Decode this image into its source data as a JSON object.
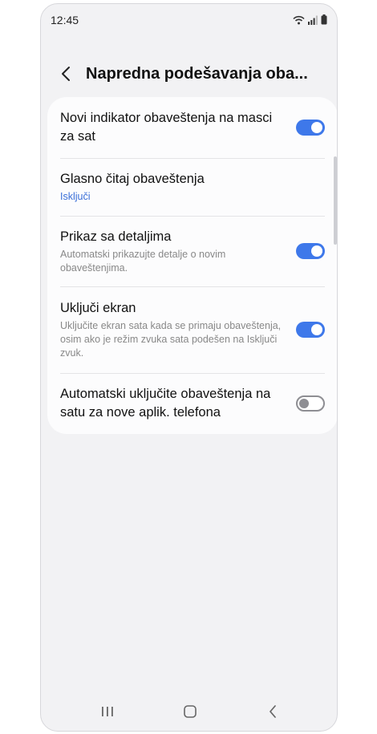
{
  "status_bar": {
    "time": "12:45"
  },
  "header": {
    "title": "Napredna podešavanja oba..."
  },
  "settings": [
    {
      "title": "Novi indikator obaveštenja na masci za sat",
      "subtitle": "",
      "toggle": true
    },
    {
      "title": "Glasno čitaj obaveštenja",
      "subtitle": "Isključi",
      "subtitle_color": "#3a6fd8"
    },
    {
      "title": "Prikaz sa detaljima",
      "subtitle": "Automatski prikazujte detalje o novim obaveštenjima.",
      "toggle": true
    },
    {
      "title": "Uključi ekran",
      "subtitle": "Uključite ekran sata kada se primaju obaveštenja, osim ako je režim zvuka sata podešen na Isključi zvuk.",
      "toggle": true
    },
    {
      "title": "Automatski uključite obaveštenja na satu za nove aplik. telefona",
      "subtitle": "",
      "toggle": false
    }
  ],
  "colors": {
    "accent": "#3e78ea",
    "background": "#f2f2f4",
    "card": "#fcfcfd"
  },
  "icons": [
    "wifi-icon",
    "signal-icon",
    "battery-icon",
    "back-arrow-icon",
    "recent-apps-icon",
    "home-icon",
    "nav-back-icon"
  ]
}
